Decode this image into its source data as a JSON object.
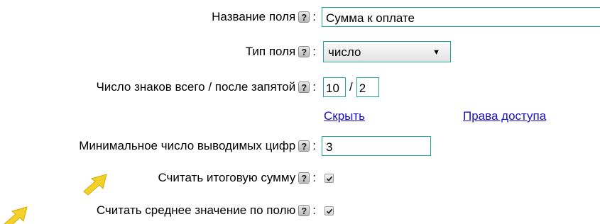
{
  "form": {
    "field_name": {
      "label": "Название поля",
      "value": "Сумма к оплате"
    },
    "field_type": {
      "label": "Тип поля",
      "selected": "число"
    },
    "digits": {
      "label": "Число знаков всего / после запятой",
      "total": "10",
      "separator": "/",
      "after_comma": "2"
    },
    "links": {
      "hide": "Скрыть",
      "access_rights": "Права доступа"
    },
    "min_digits": {
      "label": "Минимальное число выводимых цифр",
      "value": "3"
    },
    "calc_total": {
      "label": "Считать итоговую сумму",
      "checked": true
    },
    "calc_average": {
      "label": "Считать среднее значение по полю",
      "checked": true
    },
    "help_glyph": "?",
    "colon": ":"
  },
  "icons": {
    "help": "help-icon",
    "select_arrow": "dropdown-arrow-icon",
    "pointer": "yellow-arrow-pointer-icon"
  },
  "colors": {
    "input_border": "#1fa89a",
    "link": "#1a0dcc",
    "pointer_arrow": "#f2d22a"
  }
}
